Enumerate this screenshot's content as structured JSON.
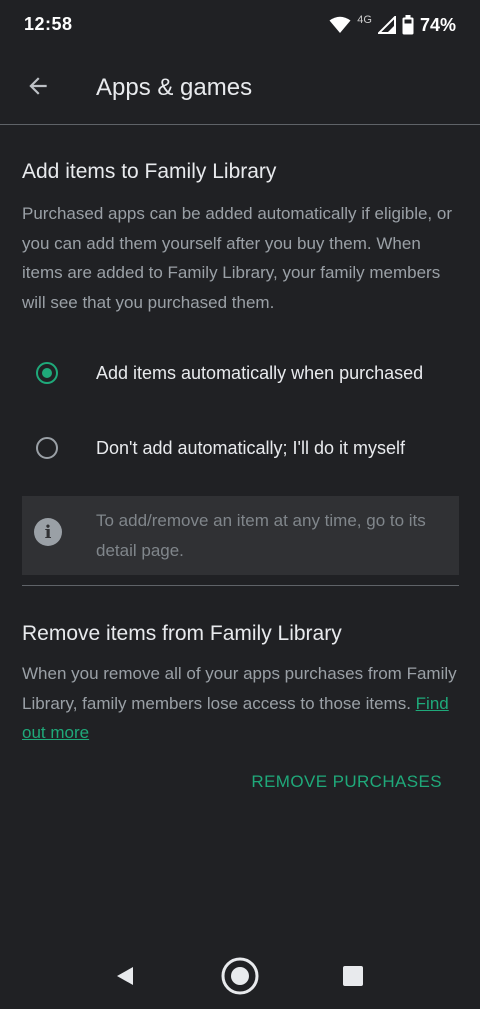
{
  "status_bar": {
    "time": "12:58",
    "network_label": "4G",
    "battery": "74%",
    "icons": [
      "wifi-icon",
      "cellular-signal-icon",
      "battery-icon"
    ]
  },
  "app_bar": {
    "title": "Apps & games",
    "back_icon": "arrow-left-icon"
  },
  "add_section": {
    "title": "Add items to Family Library",
    "description": "Purchased apps can be added automatically if eligible, or you can add them yourself after you buy them. When items are added to Family Library, your family members will see that you purchased them.",
    "options": [
      {
        "label": "Add items automatically when purchased",
        "selected": true
      },
      {
        "label": "Don't add automatically; I'll do it myself",
        "selected": false
      }
    ],
    "info": "To add/remove an item at any time, go to its detail page."
  },
  "remove_section": {
    "title": "Remove items from Family Library",
    "description": "When you remove all of your apps purchases from Family Library, family members lose access to those items.",
    "link_label": "Find out more",
    "action_label": "REMOVE PURCHASES"
  },
  "nav_bar": {
    "icons": [
      "back-triangle-icon",
      "home-circle-icon",
      "recents-square-icon"
    ]
  },
  "colors": {
    "background": "#202124",
    "accent": "#1fa97a",
    "secondary_text": "#9aa0a6",
    "info_background": "#303134"
  }
}
